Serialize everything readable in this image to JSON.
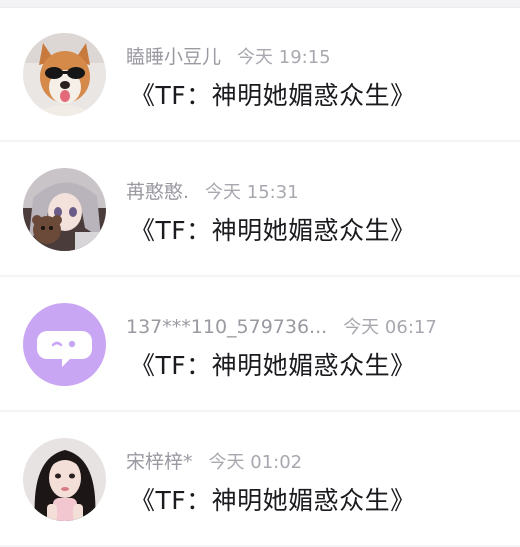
{
  "comments": [
    {
      "username": "瞌睡小豆儿",
      "time": "今天 19:15",
      "message": "《TF：神明她媚惑众生》",
      "avatar_icon": "dog-with-sunglasses-photo"
    },
    {
      "username": "苒憨憨.",
      "time": "今天 15:31",
      "message": "《TF：神明她媚惑众生》",
      "avatar_icon": "anime-girl-avatar"
    },
    {
      "username": "137***110_579736...",
      "time": "今天 06:17",
      "message": "《TF：神明她媚惑众生》",
      "avatar_icon": "chat-bubble-default-avatar"
    },
    {
      "username": "宋梓梓*",
      "time": "今天 01:02",
      "message": "《TF：神明她媚惑众生》",
      "avatar_icon": "girl-selfie-photo"
    }
  ],
  "colors": {
    "default_avatar_bg": "#c9a6f4",
    "name_gray": "#9a9aa2",
    "message_black": "#1b1b1f"
  }
}
